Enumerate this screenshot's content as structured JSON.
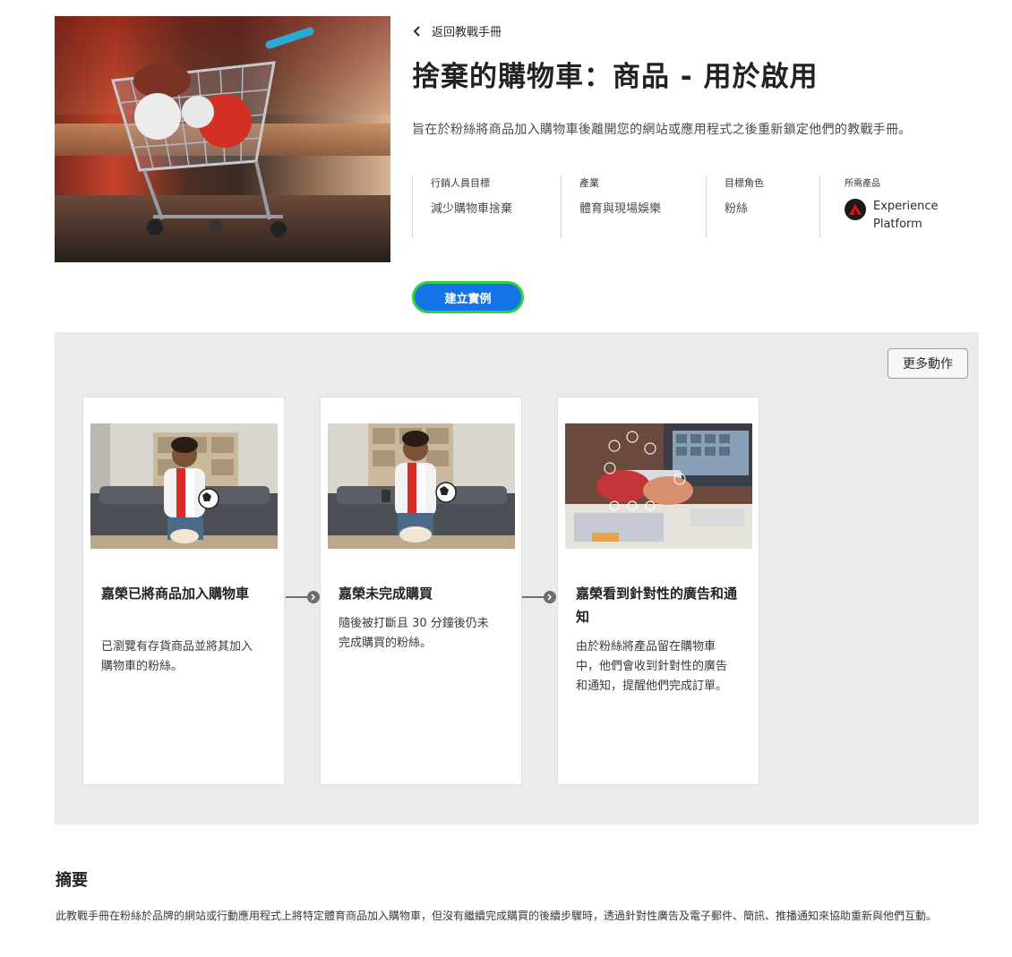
{
  "hero": {
    "image_alt": "shopping-cart-with-sports-balls",
    "back_link": "返回教戰手冊",
    "title": "捨棄的購物車：商品 - 用於啟用",
    "description": "旨在於粉絲將商品加入購物車後離開您的網站或應用程式之後重新鎖定他們的教戰手冊。"
  },
  "meta": [
    {
      "label": "行銷人員目標",
      "value": "減少購物車捨棄"
    },
    {
      "label": "產業",
      "value": "體育與現場娛樂"
    },
    {
      "label": "目標角色",
      "value": "粉絲"
    }
  ],
  "required_products": {
    "label": "所需產品",
    "product_name": "Experience Platform",
    "icon": "adobe-logo-icon"
  },
  "cta": {
    "label": "建立實例"
  },
  "journey": {
    "more_actions": "更多動作",
    "steps": [
      {
        "title": "嘉榮已將商品加入購物車",
        "body": "已瀏覽有存貨商品並將其加入購物車的粉絲。"
      },
      {
        "title": "嘉榮未完成購買",
        "body": "隨後被打斷且 30 分鐘後仍未完成購買的粉絲。"
      },
      {
        "title": "嘉榮看到針對性的廣告和通知",
        "body": "由於粉絲將產品留在購物車中，他們會收到針對性的廣告和通知，提醒他們完成訂單。"
      }
    ]
  },
  "summary": {
    "heading": "摘要",
    "text": "此教戰手冊在粉絲於品牌的網站或行動應用程式上將特定體育商品加入購物車，但沒有繼續完成購買的後續步驟時，透過針對性廣告及電子郵件、簡訊、推播通知來協助重新與他們互動。"
  },
  "colors": {
    "cta_bg": "#1473e6",
    "cta_focus_ring": "#2fd13f",
    "panel_bg": "#ebebeb",
    "adobe_red": "#eb1000"
  }
}
